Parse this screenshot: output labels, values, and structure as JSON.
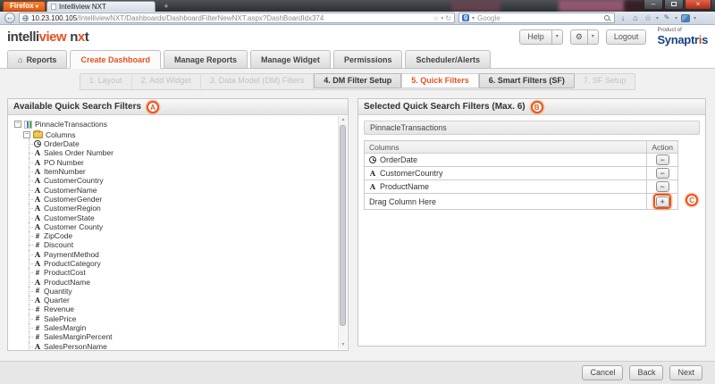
{
  "colors": {
    "accent": "#e8501f",
    "brand_blue": "#17417e",
    "brand_red": "#d53a27"
  },
  "icons": {
    "dropdown": "▾",
    "minus": "−",
    "plus": "+",
    "close": "×",
    "minimize": "–",
    "new_tab": "+",
    "back_arrow": "←",
    "reload": "↻",
    "star": "☆",
    "download": "↓",
    "home": "⌂",
    "gear": "⚙",
    "scroll_up": "▲",
    "scroll_down": "▼",
    "collapse": "−",
    "google": "g"
  },
  "browser": {
    "menu_button": "Firefox",
    "tab_title": "Intelliview NXT",
    "url_host": "10.23.100.105",
    "url_path": "/IntelliviewNXT/Dashboards/DashboardFilterNewNXT.aspx?DashBoardIdx374",
    "search_text": "Google"
  },
  "header": {
    "logo_part1": "intelli",
    "logo_part2": "view",
    "logo_part3": "n",
    "logo_part4": "x",
    "logo_part5": "t",
    "help_label": "Help",
    "logout_label": "Logout",
    "brand_product_of": "Product of",
    "brand_name_pre": "Synaptr",
    "brand_name_i": "i",
    "brand_name_post": "s"
  },
  "tabs": [
    {
      "label": "Reports",
      "active": false,
      "icon": "home"
    },
    {
      "label": "Create Dashboard",
      "active": true
    },
    {
      "label": "Manage Reports",
      "active": false
    },
    {
      "label": "Manage Widget",
      "active": false
    },
    {
      "label": "Permissions",
      "active": false
    },
    {
      "label": "Scheduler/Alerts",
      "active": false
    }
  ],
  "steps": [
    {
      "label": "1. Layout",
      "state": "disabled"
    },
    {
      "label": "2. Add Widget",
      "state": "disabled"
    },
    {
      "label": "3. Data Model (DM) Filters",
      "state": "disabled"
    },
    {
      "label": "4. DM Filter Setup",
      "state": "enabled"
    },
    {
      "label": "5. Quick Filters",
      "state": "active"
    },
    {
      "label": "6. Smart Filters (SF)",
      "state": "enabled"
    },
    {
      "label": "7. SF Setup",
      "state": "disabled"
    }
  ],
  "left_panel": {
    "title": "Available Quick Search Filters",
    "badge": "A",
    "tree": {
      "root": "PinnacleTransactions",
      "folder": "Columns",
      "items": [
        {
          "name": "OrderDate",
          "type": "datetime"
        },
        {
          "name": "Sales Order Number",
          "type": "text"
        },
        {
          "name": "PO Number",
          "type": "text"
        },
        {
          "name": "ItemNumber",
          "type": "text"
        },
        {
          "name": "CustomerCountry",
          "type": "text"
        },
        {
          "name": "CustomerName",
          "type": "text"
        },
        {
          "name": "CustomerGender",
          "type": "text"
        },
        {
          "name": "CustomerRegion",
          "type": "text"
        },
        {
          "name": "CustomerState",
          "type": "text"
        },
        {
          "name": "Customer County",
          "type": "text"
        },
        {
          "name": "ZipCode",
          "type": "number"
        },
        {
          "name": "Discount",
          "type": "number"
        },
        {
          "name": "PaymentMethod",
          "type": "text"
        },
        {
          "name": "ProductCategory",
          "type": "text"
        },
        {
          "name": "ProductCost",
          "type": "number"
        },
        {
          "name": "ProductName",
          "type": "text"
        },
        {
          "name": "Quantity",
          "type": "number"
        },
        {
          "name": "Quarter",
          "type": "text"
        },
        {
          "name": "Revenue",
          "type": "number"
        },
        {
          "name": "SalePrice",
          "type": "number"
        },
        {
          "name": "SalesMargin",
          "type": "number"
        },
        {
          "name": "SalesMarginPercent",
          "type": "number"
        },
        {
          "name": "SalesPersonName",
          "type": "text"
        }
      ]
    }
  },
  "right_panel": {
    "title": "Selected Quick Search Filters (Max. 6)",
    "badge": "B",
    "dataset": "PinnacleTransactions",
    "table": {
      "col_columns": "Columns",
      "col_action": "Action",
      "rows": [
        {
          "name": "OrderDate",
          "type": "datetime"
        },
        {
          "name": "CustomerCountry",
          "type": "text"
        },
        {
          "name": "ProductName",
          "type": "text"
        }
      ],
      "drag_label": "Drag Column Here",
      "drag_badge": "C"
    }
  },
  "footer": {
    "buttons": [
      "Cancel",
      "Back",
      "Next"
    ]
  }
}
